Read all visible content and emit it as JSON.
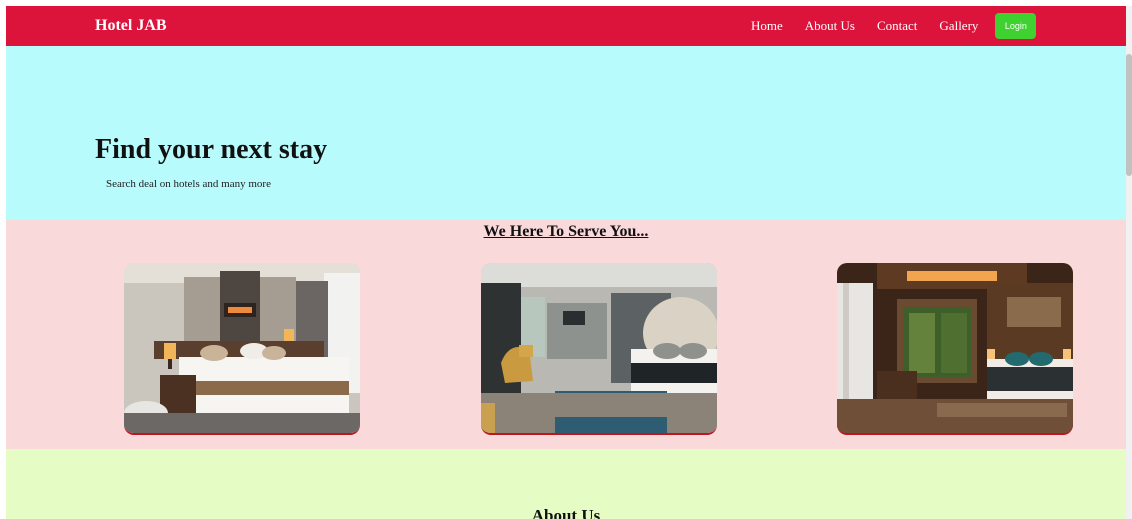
{
  "navbar": {
    "brand": "Hotel JAB",
    "links": [
      {
        "label": "Home"
      },
      {
        "label": "About Us"
      },
      {
        "label": "Contact"
      },
      {
        "label": "Gallery"
      }
    ],
    "login_label": "Login",
    "bg_color": "#dc143c",
    "login_color": "#3ed12f"
  },
  "hero": {
    "title": "Find your next stay",
    "subtitle": "Search deal on hotels and many more",
    "bg_color": "#b8fbfd"
  },
  "services": {
    "heading": "We Here To Serve You...",
    "bg_color": "#fad9db",
    "rooms": [
      {
        "icon": "hotel-room-photo"
      },
      {
        "icon": "hotel-room-photo"
      },
      {
        "icon": "hotel-room-photo"
      }
    ]
  },
  "about": {
    "heading": "About Us",
    "bg_color": "#e5fcc4"
  }
}
